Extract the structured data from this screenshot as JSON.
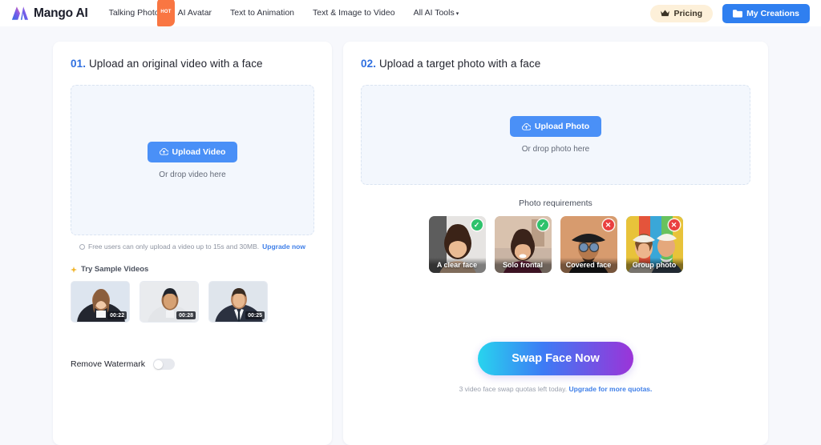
{
  "nav": {
    "brand": "Mango AI",
    "links": [
      {
        "label": "Talking Photo",
        "badge": "HOT"
      },
      {
        "label": "AI Avatar",
        "badge": ""
      },
      {
        "label": "Text to Animation",
        "badge": ""
      },
      {
        "label": "Text & Image to Video",
        "badge": ""
      },
      {
        "label": "All AI Tools",
        "badge": ""
      }
    ],
    "caret": "▾",
    "pricing_label": "Pricing",
    "creations_label": "My Creations",
    "pricing_icon": "crown-icon",
    "creations_icon": "folder-icon"
  },
  "left": {
    "step": "01.",
    "title": "Upload an original video with a face",
    "upload_button": "Upload Video",
    "upload_icon": "cloud-upload-icon",
    "drop_hint": "Or drop video here",
    "note_text": "Free users can only upload a video up to 15s and 30MB.",
    "note_link": "Upgrade now",
    "samples_label": "Try Sample Videos",
    "samples": [
      {
        "name": "sample-video-1",
        "duration": "00:22"
      },
      {
        "name": "sample-video-2",
        "duration": "00:28"
      },
      {
        "name": "sample-video-3",
        "duration": "00:25"
      }
    ],
    "watermark_label": "Remove Watermark",
    "watermark_state": "off"
  },
  "right": {
    "step": "02.",
    "title": "Upload a target photo with a face",
    "upload_button": "Upload Photo",
    "upload_icon": "cloud-upload-icon",
    "drop_hint": "Or drop photo here",
    "requirements_title": "Photo requirements",
    "requirements": [
      {
        "caption": "A clear face",
        "status": "ok",
        "mark": "✓"
      },
      {
        "caption": "Solo frontal",
        "status": "ok",
        "mark": "✓"
      },
      {
        "caption": "Covered face",
        "status": "no",
        "mark": "✕"
      },
      {
        "caption": "Group photo",
        "status": "no",
        "mark": "✕"
      }
    ],
    "swap_button": "Swap Face Now",
    "quota_text": "3 video face swap quotas left today.",
    "quota_link": "Upgrade for more quotas."
  },
  "colors": {
    "accent_blue": "#4a90f7",
    "nav_blue": "#2f7ff0",
    "step_blue": "#2f6fe0",
    "badge_orange": "#f97642",
    "pricing_bg": "#fdf0d9",
    "ok_green": "#2ec26c",
    "no_red": "#ea3f3f",
    "page_bg": "#f7f8fc",
    "dropzone_bg": "#f3f7fd"
  }
}
